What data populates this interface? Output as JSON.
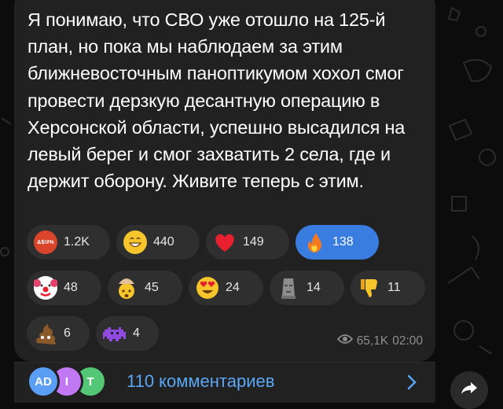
{
  "post": {
    "text": "Я понимаю, что СВО уже отошло на 125-й план, но пока мы наблюдаем за этим ближневосточным паноптикумом хохол смог провести дерзкую десантную операцию в Херсонской области, успешно высадился на левый берег и смог захватить 2 села, где и держит оборону. Живите теперь с этим."
  },
  "reactions": [
    {
      "icon": "swearing-face-icon",
      "count": "1.2K",
      "symbol": "&$!#%"
    },
    {
      "icon": "grinning-face-icon",
      "count": "440"
    },
    {
      "icon": "red-heart-icon",
      "count": "149"
    },
    {
      "icon": "fire-icon",
      "count": "138",
      "active": true
    },
    {
      "icon": "clown-face-icon",
      "count": "48"
    },
    {
      "icon": "exploding-head-icon",
      "count": "45"
    },
    {
      "icon": "heart-eyes-icon",
      "count": "24"
    },
    {
      "icon": "moai-icon",
      "count": "14"
    },
    {
      "icon": "thumbs-down-icon",
      "count": "11"
    },
    {
      "icon": "poop-icon",
      "count": "6"
    },
    {
      "icon": "space-invader-icon",
      "count": "4"
    }
  ],
  "meta": {
    "views": "65,1K",
    "time": "02:00"
  },
  "comments": {
    "avatars": [
      {
        "label": "AD",
        "color": "#5b9ef5"
      },
      {
        "label": "I",
        "color": "#c278f4"
      },
      {
        "label": "T",
        "color": "#54c776"
      }
    ],
    "label": "110 комментариев"
  },
  "colors": {
    "accent": "#3a7de0",
    "link": "#5aa7f5",
    "bubble": "#212121",
    "background": "#0c0c0c"
  }
}
